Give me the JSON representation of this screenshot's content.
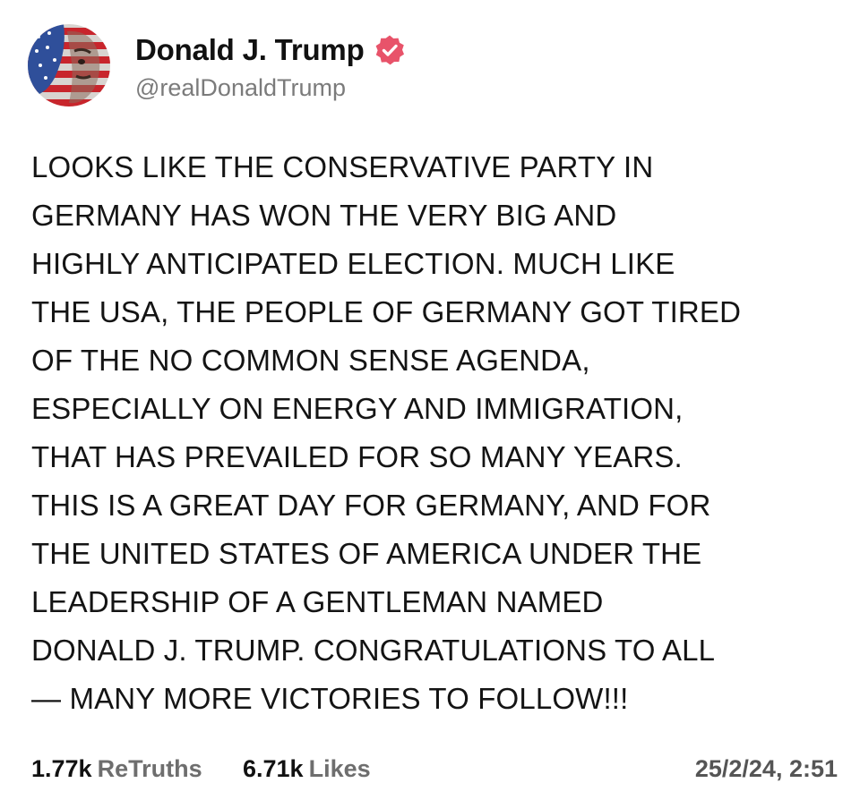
{
  "author": {
    "display_name": "Donald J. Trump",
    "handle": "@realDonaldTrump",
    "verified": true,
    "verified_icon": "verified-badge-icon"
  },
  "post": {
    "lines": [
      "LOOKS LIKE THE CONSERVATIVE PARTY IN",
      "GERMANY HAS WON THE VERY BIG AND",
      "HIGHLY ANTICIPATED ELECTION. MUCH LIKE",
      "THE USA, THE PEOPLE OF GERMANY GOT TIRED",
      "OF THE NO COMMON SENSE AGENDA,",
      "ESPECIALLY ON ENERGY AND IMMIGRATION,",
      "THAT HAS PREVAILED FOR SO MANY YEARS.",
      "THIS IS A GREAT DAY FOR GERMANY, AND FOR",
      "THE UNITED STATES OF AMERICA UNDER THE",
      "LEADERSHIP OF A GENTLEMAN NAMED",
      "DONALD J. TRUMP. CONGRATULATIONS TO ALL",
      "— MANY MORE VICTORIES TO FOLLOW!!!"
    ]
  },
  "stats": {
    "retruths_count": "1.77k",
    "retruths_label": "ReTruths",
    "likes_count": "6.71k",
    "likes_label": "Likes",
    "timestamp": "25/2/24, 2:51"
  },
  "colors": {
    "verified_badge": "#e8536a",
    "text": "#141414",
    "muted": "#7b7b7b"
  }
}
